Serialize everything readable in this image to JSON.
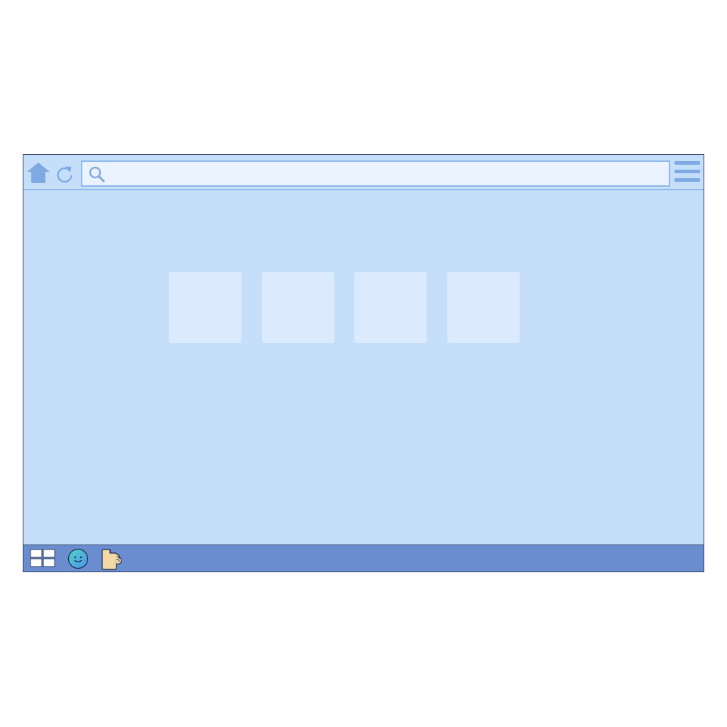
{
  "browser": {
    "search": {
      "value": "",
      "placeholder": ""
    },
    "toolbar": {
      "icons": [
        "home-icon",
        "reload-icon",
        "search-icon",
        "hamburger-menu-icon"
      ]
    },
    "shortcut_tiles": [
      {
        "label": ""
      },
      {
        "label": ""
      },
      {
        "label": ""
      },
      {
        "label": ""
      }
    ]
  },
  "taskbar": {
    "icons": [
      "start-grid-icon",
      "smiley-globe-icon",
      "folder-hand-icon"
    ]
  },
  "colors": {
    "window_bg": "#c5dffb",
    "toolbar_border": "#8fb8ec",
    "search_bg": "#eaf3ff",
    "tile_bg": "#dbeafd",
    "taskbar_bg": "#6a8dd0",
    "frame": "#2d3d5c"
  }
}
